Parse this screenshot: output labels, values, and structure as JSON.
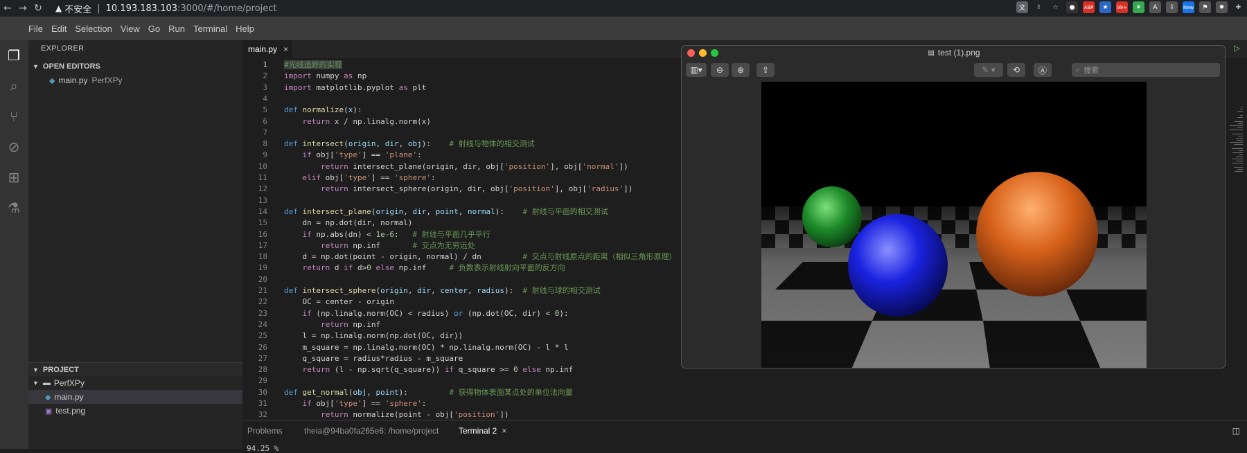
{
  "browser": {
    "insecure_label": "不安全",
    "url_host": "10.193.183.103",
    "url_path": ":3000/#/home/project",
    "ext_badges": [
      "ABP",
      "99+",
      "New"
    ]
  },
  "menu": [
    "File",
    "Edit",
    "Selection",
    "View",
    "Go",
    "Run",
    "Terminal",
    "Help"
  ],
  "sidebar": {
    "title": "EXPLORER",
    "open_editors_label": "OPEN EDITORS",
    "open_editor_file": "main.py",
    "open_editor_folder": "PerfXPy",
    "project_label": "PROJECT",
    "root_folder": "PerfXPy",
    "files": [
      "main.py",
      "test.png"
    ]
  },
  "editor": {
    "tab_label": "main.py",
    "lines": [
      [
        [
          "cm",
          "#光线追踪的实现"
        ]
      ],
      [
        [
          "kw2",
          "import"
        ],
        [
          "t",
          " numpy "
        ],
        [
          "kw2",
          "as"
        ],
        [
          "t",
          " np"
        ]
      ],
      [
        [
          "kw2",
          "import"
        ],
        [
          "t",
          " matplotlib.pyplot "
        ],
        [
          "kw2",
          "as"
        ],
        [
          "t",
          " plt"
        ]
      ],
      [],
      [
        [
          "kw",
          "def"
        ],
        [
          "t",
          " "
        ],
        [
          "fn",
          "normalize"
        ],
        [
          "t",
          "("
        ],
        [
          "param",
          "x"
        ],
        [
          "t",
          "):"
        ]
      ],
      [
        [
          "t",
          "    "
        ],
        [
          "kw2",
          "return"
        ],
        [
          "t",
          " x / np.linalg.norm(x)"
        ]
      ],
      [],
      [
        [
          "kw",
          "def"
        ],
        [
          "t",
          " "
        ],
        [
          "fn",
          "intersect"
        ],
        [
          "t",
          "("
        ],
        [
          "param",
          "origin"
        ],
        [
          "t",
          ", "
        ],
        [
          "param",
          "dir"
        ],
        [
          "t",
          ", "
        ],
        [
          "param",
          "obj"
        ],
        [
          "t",
          "):    "
        ],
        [
          "cm",
          "# 射线与物体的相交测试"
        ]
      ],
      [
        [
          "t",
          "    "
        ],
        [
          "kw2",
          "if"
        ],
        [
          "t",
          " obj["
        ],
        [
          "str",
          "'type'"
        ],
        [
          "t",
          "] == "
        ],
        [
          "str",
          "'plane'"
        ],
        [
          "t",
          ":"
        ]
      ],
      [
        [
          "t",
          "        "
        ],
        [
          "kw2",
          "return"
        ],
        [
          "t",
          " intersect_plane(origin, dir, obj["
        ],
        [
          "str",
          "'position'"
        ],
        [
          "t",
          "], obj["
        ],
        [
          "str",
          "'normal'"
        ],
        [
          "t",
          "])"
        ]
      ],
      [
        [
          "t",
          "    "
        ],
        [
          "kw2",
          "elif"
        ],
        [
          "t",
          " obj["
        ],
        [
          "str",
          "'type'"
        ],
        [
          "t",
          "] == "
        ],
        [
          "str",
          "'sphere'"
        ],
        [
          "t",
          ":"
        ]
      ],
      [
        [
          "t",
          "        "
        ],
        [
          "kw2",
          "return"
        ],
        [
          "t",
          " intersect_sphere(origin, dir, obj["
        ],
        [
          "str",
          "'position'"
        ],
        [
          "t",
          "], obj["
        ],
        [
          "str",
          "'radius'"
        ],
        [
          "t",
          "])"
        ]
      ],
      [],
      [
        [
          "kw",
          "def"
        ],
        [
          "t",
          " "
        ],
        [
          "fn",
          "intersect_plane"
        ],
        [
          "t",
          "("
        ],
        [
          "param",
          "origin"
        ],
        [
          "t",
          ", "
        ],
        [
          "param",
          "dir"
        ],
        [
          "t",
          ", "
        ],
        [
          "param",
          "point"
        ],
        [
          "t",
          ", "
        ],
        [
          "param",
          "normal"
        ],
        [
          "t",
          "):    "
        ],
        [
          "cm",
          "# 射线与平面的相交测试"
        ]
      ],
      [
        [
          "t",
          "    dn = np.dot(dir, normal)"
        ]
      ],
      [
        [
          "t",
          "    "
        ],
        [
          "kw2",
          "if"
        ],
        [
          "t",
          " np.abs(dn) < "
        ],
        [
          "num",
          "1e-6"
        ],
        [
          "t",
          ":   "
        ],
        [
          "cm",
          "# 射线与平面几乎平行"
        ]
      ],
      [
        [
          "t",
          "        "
        ],
        [
          "kw2",
          "return"
        ],
        [
          "t",
          " np.inf       "
        ],
        [
          "cm",
          "# 交点为无穷远处"
        ]
      ],
      [
        [
          "t",
          "    d = np.dot(point - origin, normal) / dn         "
        ],
        [
          "cm",
          "# 交点与射线原点的距离（相似三角形原理）"
        ]
      ],
      [
        [
          "t",
          "    "
        ],
        [
          "kw2",
          "return"
        ],
        [
          "t",
          " d "
        ],
        [
          "kw2",
          "if"
        ],
        [
          "t",
          " d>"
        ],
        [
          "num",
          "0"
        ],
        [
          "t",
          " "
        ],
        [
          "kw2",
          "else"
        ],
        [
          "t",
          " np.inf     "
        ],
        [
          "cm",
          "# 负数表示射线射向平面的反方向"
        ]
      ],
      [],
      [
        [
          "kw",
          "def"
        ],
        [
          "t",
          " "
        ],
        [
          "fn",
          "intersect_sphere"
        ],
        [
          "t",
          "("
        ],
        [
          "param",
          "origin"
        ],
        [
          "t",
          ", "
        ],
        [
          "param",
          "dir"
        ],
        [
          "t",
          ", "
        ],
        [
          "param",
          "center"
        ],
        [
          "t",
          ", "
        ],
        [
          "param",
          "radius"
        ],
        [
          "t",
          "):  "
        ],
        [
          "cm",
          "# 射线与球的相交测试"
        ]
      ],
      [
        [
          "t",
          "    OC = center - origin"
        ]
      ],
      [
        [
          "t",
          "    "
        ],
        [
          "kw2",
          "if"
        ],
        [
          "t",
          " (np.linalg.norm(OC) < radius) "
        ],
        [
          "kw",
          "or"
        ],
        [
          "t",
          " (np.dot(OC, dir) < "
        ],
        [
          "num",
          "0"
        ],
        [
          "t",
          "):"
        ]
      ],
      [
        [
          "t",
          "        "
        ],
        [
          "kw2",
          "return"
        ],
        [
          "t",
          " np.inf"
        ]
      ],
      [
        [
          "t",
          "    l = np.linalg.norm(np.dot(OC, dir))"
        ]
      ],
      [
        [
          "t",
          "    m_square = np.linalg.norm(OC) * np.linalg.norm(OC) - l * l"
        ]
      ],
      [
        [
          "t",
          "    q_square = radius*radius - m_square"
        ]
      ],
      [
        [
          "t",
          "    "
        ],
        [
          "kw2",
          "return"
        ],
        [
          "t",
          " (l - np.sqrt(q_square)) "
        ],
        [
          "kw2",
          "if"
        ],
        [
          "t",
          " q_square >= "
        ],
        [
          "num",
          "0"
        ],
        [
          "t",
          " "
        ],
        [
          "kw2",
          "else"
        ],
        [
          "t",
          " np.inf"
        ]
      ],
      [],
      [
        [
          "kw",
          "def"
        ],
        [
          "t",
          " "
        ],
        [
          "fn",
          "get_normal"
        ],
        [
          "t",
          "("
        ],
        [
          "param",
          "obj"
        ],
        [
          "t",
          ", "
        ],
        [
          "param",
          "point"
        ],
        [
          "t",
          "):         "
        ],
        [
          "cm",
          "# 获得物体表面某点处的单位法向量"
        ]
      ],
      [
        [
          "t",
          "    "
        ],
        [
          "kw2",
          "if"
        ],
        [
          "t",
          " obj["
        ],
        [
          "str",
          "'type'"
        ],
        [
          "t",
          "] == "
        ],
        [
          "str",
          "'sphere'"
        ],
        [
          "t",
          ":"
        ]
      ],
      [
        [
          "t",
          "        "
        ],
        [
          "kw2",
          "return"
        ],
        [
          "t",
          " normalize(point - obj["
        ],
        [
          "str",
          "'position'"
        ],
        [
          "t",
          "])"
        ]
      ]
    ]
  },
  "panel": {
    "tabs": [
      "Problems",
      "theia@94ba0fa265e6: /home/project",
      "Terminal 2"
    ],
    "terminal_text": "94.25 %"
  },
  "preview": {
    "title": "test (1).png",
    "search_placeholder": "搜索"
  },
  "colors": {
    "sphere_green": "#1e8c2a",
    "sphere_blue": "#1a22e0",
    "sphere_orange": "#d8621a"
  }
}
